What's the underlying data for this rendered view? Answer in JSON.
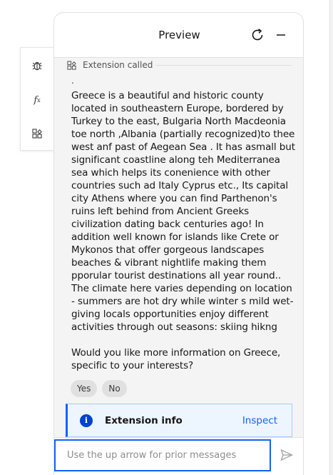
{
  "side_toolbar": {
    "items": [
      {
        "icon": "bug-icon"
      },
      {
        "icon": "function-icon",
        "label": "f",
        "sub": "x"
      },
      {
        "icon": "extension-icon"
      }
    ]
  },
  "panel": {
    "title": "Preview",
    "refresh_icon": "refresh-icon",
    "minimize_icon": "minimize-icon"
  },
  "chat": {
    "extension_called_label": "Extension called",
    "dot": ".",
    "message_paragraphs": [
      "Greece is a beautiful and historic county located in southeastern Europe, bordered by Turkey to the east, Bulgaria North Macdeonia toe north ,Albania (partially recognized)to thee west anf past of Aegean Sea . It has asmall but significant coastline along teh Mediterranea sea which helps its conenience with other countries such ad Italy Cyprus etc., Its capital city Athens where you can find Parthenon's ruins left behind from Ancient Greeks civilization dating back centuries ago! In addition well known for islands like Crete or Mykonos that offer gorgeous landscapes beaches & vibrant nightlife making them pporular tourist destinations all year round.. The climate here varies depending on location - summers are hot dry while winter s mild wet- giving locals opportunities enjoy different activities through out seasons: skiing hikng",
      "Would you like more information on Greece, specific to your interests?"
    ],
    "suggestions": [
      "Yes",
      "No"
    ]
  },
  "extension_info": {
    "title": "Extension info",
    "action": "Inspect",
    "icon": "info-icon"
  },
  "input": {
    "placeholder": "Use the up arrow for prior messages",
    "value": "",
    "send_icon": "send-icon"
  },
  "colors": {
    "accent": "#0f62fe",
    "panel_bg": "#f4f4f4",
    "info_bg": "#edf5ff"
  }
}
